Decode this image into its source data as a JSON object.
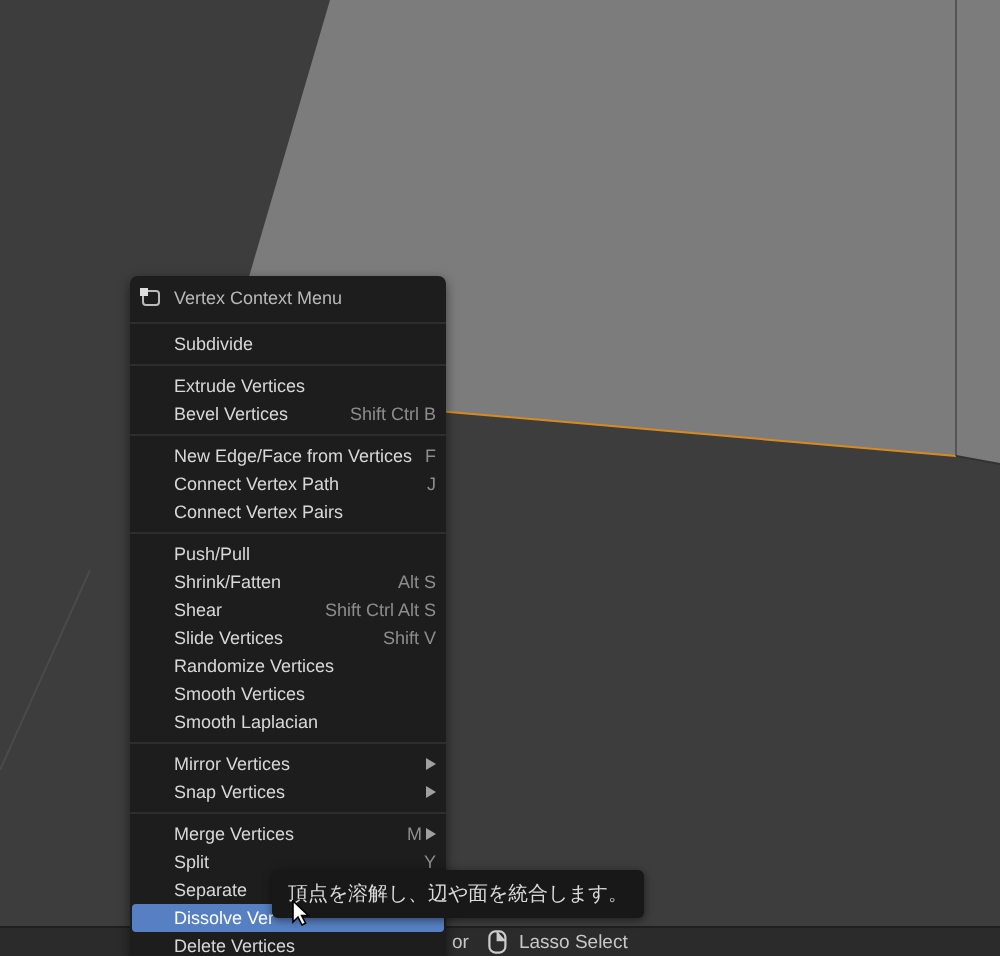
{
  "menu": {
    "title": "Vertex Context Menu",
    "sections": [
      [
        {
          "label": "Subdivide",
          "selected": false
        }
      ],
      [
        {
          "label": "Extrude Vertices",
          "selected": false
        },
        {
          "label": "Bevel Vertices",
          "shortcut": "Shift Ctrl B",
          "selected": false
        }
      ],
      [
        {
          "label": "New Edge/Face from Vertices",
          "shortcut": "F",
          "selected": false
        },
        {
          "label": "Connect Vertex Path",
          "shortcut": "J",
          "selected": false
        },
        {
          "label": "Connect Vertex Pairs",
          "selected": false
        }
      ],
      [
        {
          "label": "Push/Pull",
          "selected": false
        },
        {
          "label": "Shrink/Fatten",
          "shortcut": "Alt S",
          "selected": false
        },
        {
          "label": "Shear",
          "shortcut": "Shift Ctrl Alt S",
          "selected": false
        },
        {
          "label": "Slide Vertices",
          "shortcut": "Shift V",
          "selected": false
        },
        {
          "label": "Randomize Vertices",
          "selected": false
        },
        {
          "label": "Smooth Vertices",
          "selected": false
        },
        {
          "label": "Smooth Laplacian",
          "selected": false
        }
      ],
      [
        {
          "label": "Mirror Vertices",
          "submenu": true,
          "selected": false
        },
        {
          "label": "Snap Vertices",
          "submenu": true,
          "selected": false
        }
      ],
      [
        {
          "label": "Merge Vertices",
          "shortcut": "M",
          "submenu": true,
          "selected": false
        },
        {
          "label": "Split",
          "shortcut": "Y",
          "selected": false
        },
        {
          "label": "Separate",
          "selected": false
        },
        {
          "label": "Dissolve Ver",
          "selected": true
        },
        {
          "label": "Delete Vertices",
          "selected": false
        }
      ]
    ]
  },
  "tooltip": "頂点を溶解し、辺や面を統合します。",
  "status_bar": [
    {
      "kind": "text",
      "label": "or"
    },
    {
      "kind": "mouse",
      "label": "Lasso Select"
    }
  ]
}
